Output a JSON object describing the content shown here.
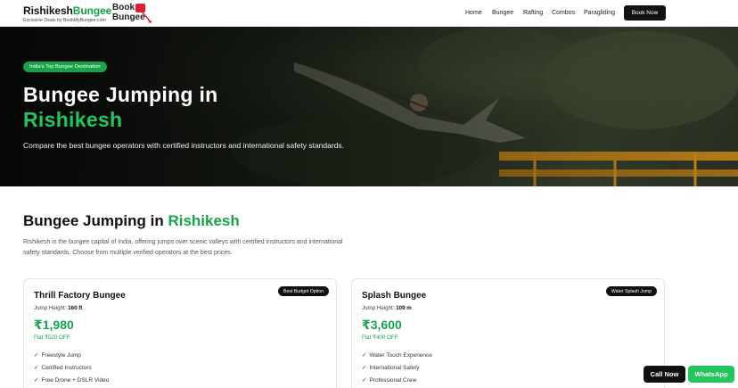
{
  "header": {
    "brand_main": "Rishikesh",
    "brand_accent": "Bungee",
    "brand_sub": "Exclusive Deals by BookMyBungee.com",
    "partner_logo_line1": "Book",
    "partner_logo_line2": "Bungee",
    "nav": [
      "Home",
      "Bungee",
      "Rafting",
      "Combos",
      "Paragliding"
    ],
    "cta_label": "Book Now"
  },
  "hero": {
    "badge": "India's Top Bungee Destination",
    "title_line1": "Bungee Jumping in",
    "title_line2": "Rishikesh",
    "description": "Compare the best bungee operators with certified instructors and international safety standards."
  },
  "section": {
    "title_main": "Bungee Jumping in ",
    "title_accent": "Rishikesh",
    "description": "Rishikesh is the bungee capital of India, offering jumps over scenic valleys with certified instructors and international safety standards. Choose from multiple verified operators at the best prices."
  },
  "operators": [
    {
      "name": "Thrill Factory Bungee",
      "badge": "Best Budget Option",
      "height_label": "Jump Height:",
      "height_value": "160 ft",
      "price": "₹1,980",
      "discount": "Flat ₹520 OFF",
      "features": [
        "Freestyle Jump",
        "Certified Instructors",
        "Free Drone + DSLR Video"
      ]
    },
    {
      "name": "Splash Bungee",
      "badge": "Water Splash Jump",
      "height_label": "Jump Height:",
      "height_value": "109 m",
      "price": "₹3,600",
      "discount": "Flat ₹400 OFF",
      "features": [
        "Water Touch Experience",
        "International Safety",
        "Professional Crew"
      ]
    }
  ],
  "floating": {
    "call_label": "Call Now",
    "whatsapp_label": "WhatsApp"
  },
  "colors": {
    "accent_green": "#16a34a",
    "dark": "#111111"
  }
}
